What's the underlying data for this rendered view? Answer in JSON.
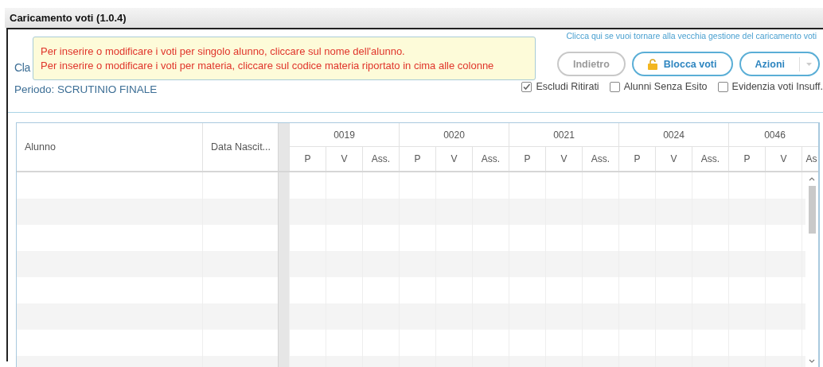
{
  "window": {
    "title": "Caricamento voti (1.0.4)"
  },
  "class_label": "Cla",
  "period": "Periodo: SCRUTINIO FINALE",
  "tooltip": {
    "lines": [
      "Per inserire o modificare i voti per singolo alunno, cliccare sul nome dell'alunno.",
      "Per inserire o modificare i voti per materia, cliccare sul codice materia riportato in cima alle colonne"
    ]
  },
  "legacy_link": "Clicca qui se vuoi tornare alla vecchia gestione del caricamento voti",
  "buttons": [
    {
      "label": "Indietro",
      "kind": "plain",
      "disabled": true
    },
    {
      "label": "Blocca voti",
      "kind": "lock",
      "disabled": false
    },
    {
      "label": "Azioni",
      "kind": "dropdown",
      "disabled": false
    }
  ],
  "filters": [
    {
      "label": "Escludi Ritirati",
      "checked": true
    },
    {
      "label": "Alunni Senza Esito",
      "checked": false
    },
    {
      "label": "Evidenzia voti Insuff.",
      "checked": false
    }
  ],
  "table": {
    "columns": [
      "Alunno",
      "Data Nascit..."
    ],
    "subjects": [
      {
        "code": "0019",
        "subcolumns": [
          "P",
          "V",
          "Ass."
        ]
      },
      {
        "code": "0020",
        "subcolumns": [
          "P",
          "V",
          "Ass."
        ]
      },
      {
        "code": "0021",
        "subcolumns": [
          "P",
          "V",
          "Ass."
        ]
      },
      {
        "code": "0024",
        "subcolumns": [
          "P",
          "V",
          "Ass."
        ]
      },
      {
        "code": "0046",
        "subcolumns": [
          "P",
          "V",
          "As"
        ]
      }
    ]
  }
}
